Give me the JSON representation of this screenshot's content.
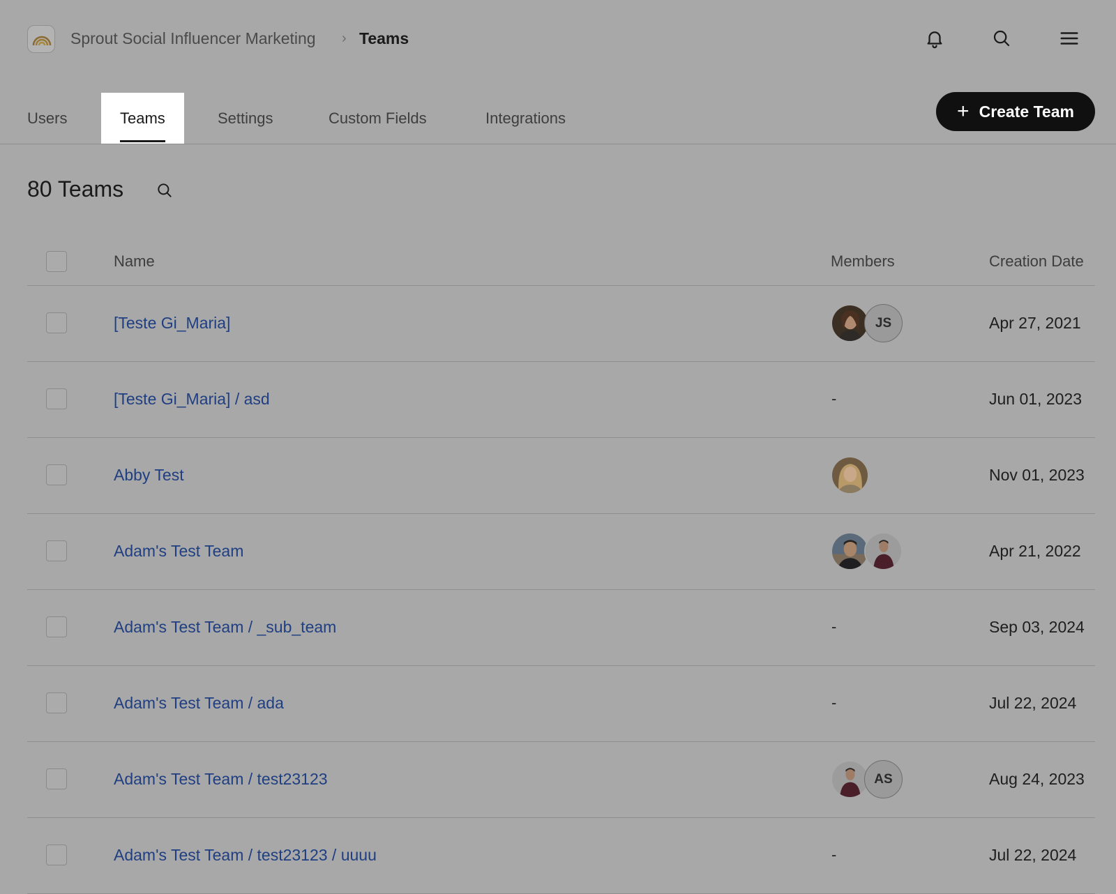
{
  "header": {
    "breadcrumb_parent": "Sprout Social Influencer Marketing",
    "breadcrumb_separator": "›",
    "breadcrumb_current": "Teams",
    "icons": [
      "bell-icon",
      "search-icon",
      "menu-icon"
    ]
  },
  "tabs": [
    {
      "label": "Users"
    },
    {
      "label": "Teams",
      "active": true
    },
    {
      "label": "Settings"
    },
    {
      "label": "Custom Fields"
    },
    {
      "label": "Integrations"
    }
  ],
  "create_button": {
    "label": "Create Team",
    "icon": "plus-icon"
  },
  "summary": {
    "count_label": "80 Teams"
  },
  "table": {
    "columns": {
      "name": "Name",
      "members": "Members",
      "creation_date": "Creation Date"
    },
    "rows": [
      {
        "name": "[Teste Gi_Maria]",
        "members": [
          {
            "type": "photo"
          },
          {
            "type": "initials",
            "text": "JS"
          }
        ],
        "date": "Apr 27, 2021"
      },
      {
        "name": "[Teste Gi_Maria] / asd",
        "members_text": "-",
        "date": "Jun 01, 2023"
      },
      {
        "name": "Abby Test",
        "members": [
          {
            "type": "photo"
          }
        ],
        "date": "Nov 01, 2023"
      },
      {
        "name": "Adam's Test Team",
        "members": [
          {
            "type": "photo"
          },
          {
            "type": "photo"
          }
        ],
        "date": "Apr 21, 2022"
      },
      {
        "name": "Adam's Test Team / _sub_team",
        "members_text": "-",
        "date": "Sep 03, 2024"
      },
      {
        "name": "Adam's Test Team / ada",
        "members_text": "-",
        "date": "Jul 22, 2024"
      },
      {
        "name": "Adam's Test Team / test23123",
        "members": [
          {
            "type": "photo"
          },
          {
            "type": "initials",
            "text": "AS"
          }
        ],
        "date": "Aug 24, 2023"
      },
      {
        "name": "Adam's Test Team / test23123 / uuuu",
        "members_text": "-",
        "date": "Jul 22, 2024"
      }
    ]
  },
  "colors": {
    "background": "#a8a8a8",
    "link": "#1f3f82",
    "button": "#101010",
    "active_tab": "#ffffff"
  }
}
